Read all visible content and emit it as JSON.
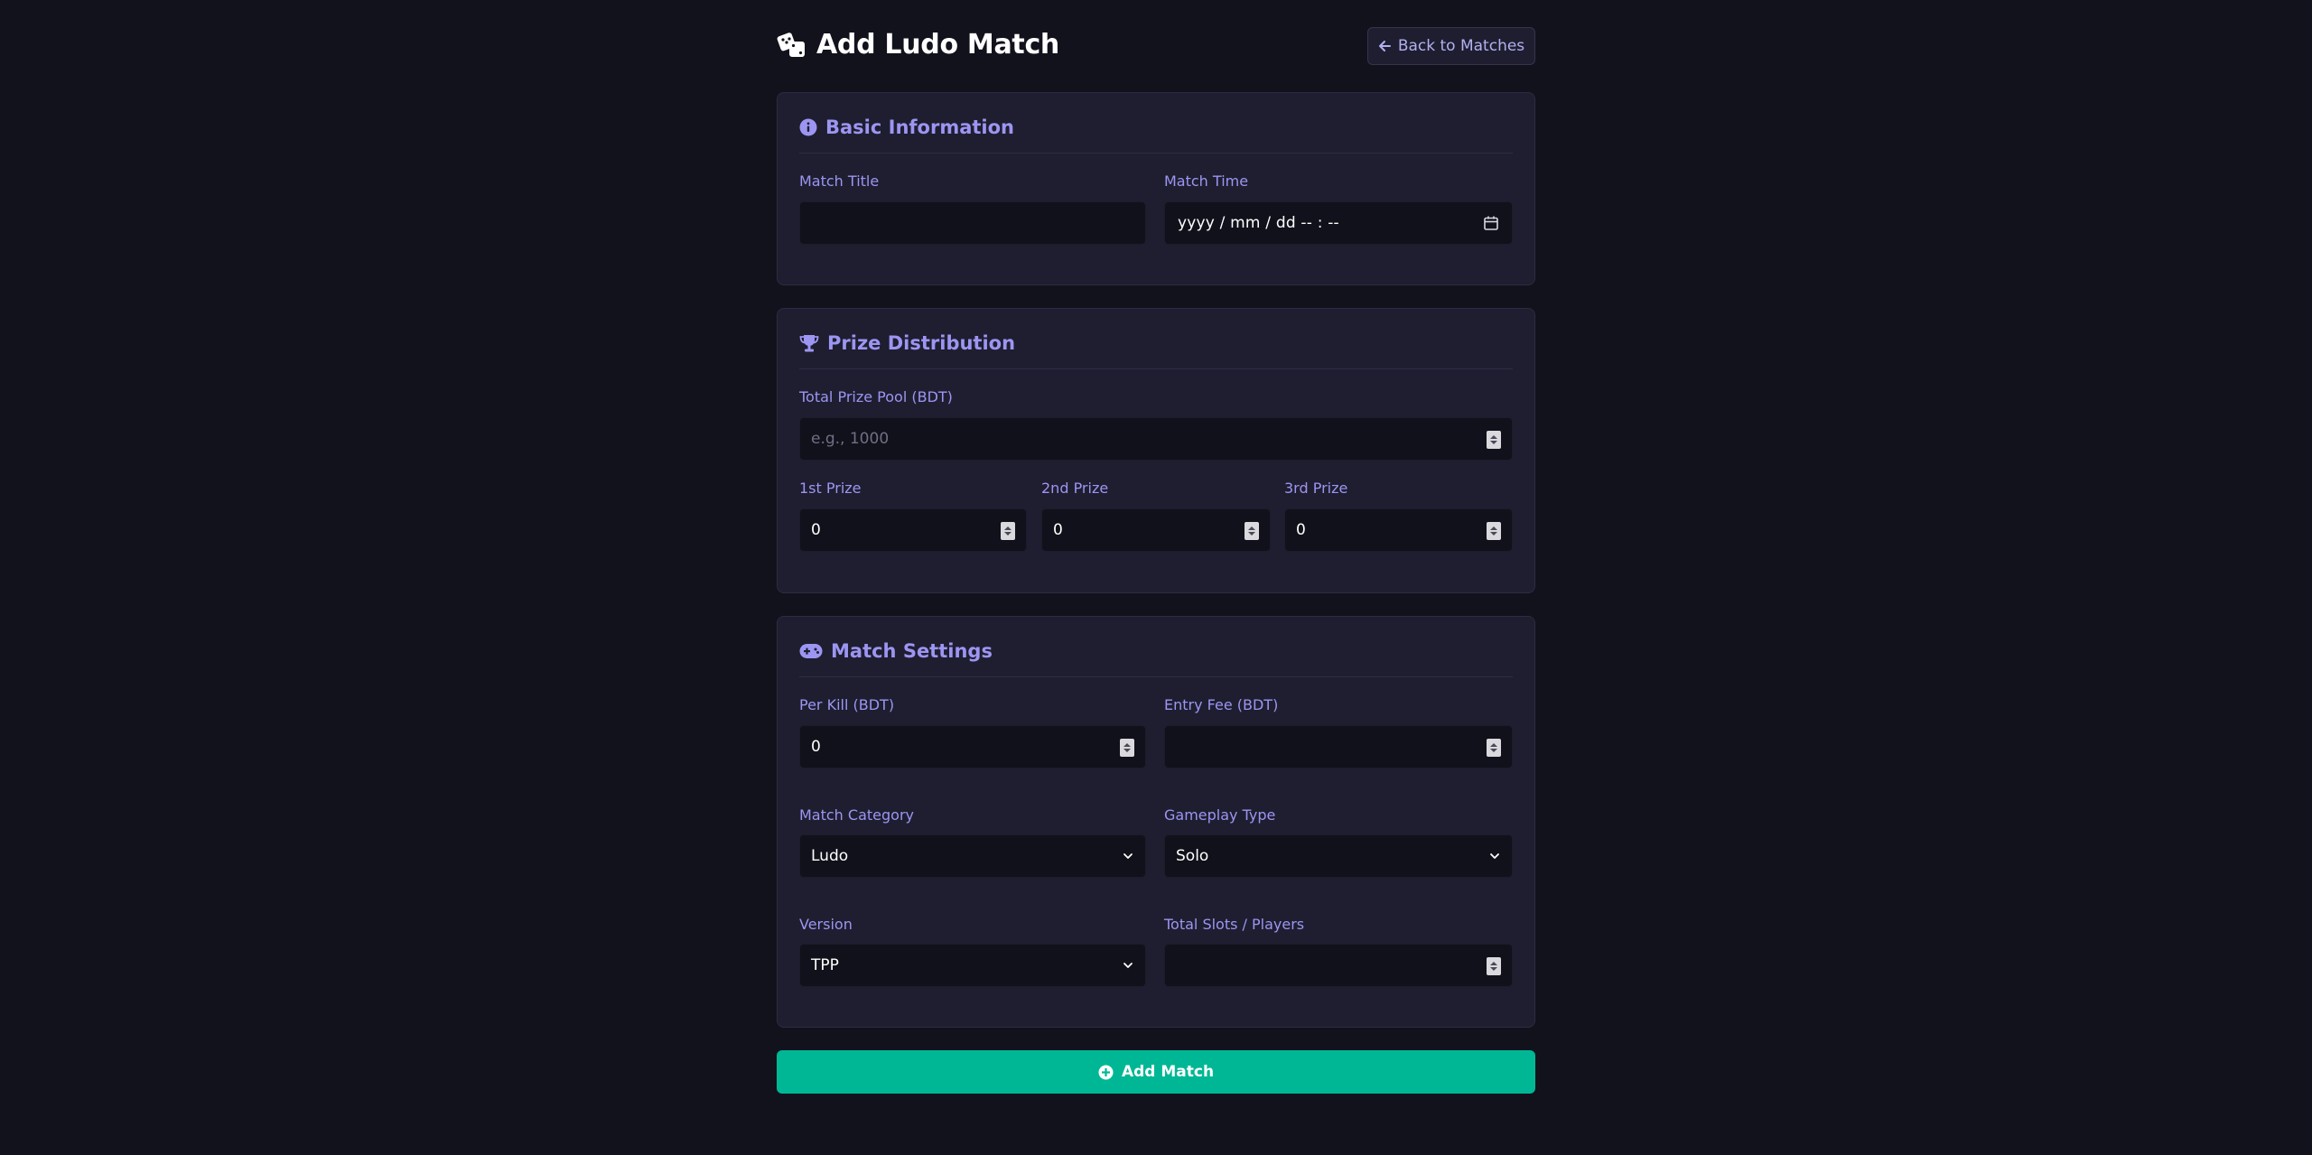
{
  "header": {
    "title": "Add Ludo Match",
    "back_label": "Back to Matches"
  },
  "basic": {
    "title": "Basic Information",
    "match_title_label": "Match Title",
    "match_title_value": "",
    "match_time_label": "Match Time",
    "match_time_placeholder": "yyyy / mm / dd  -- : --"
  },
  "prize": {
    "title": "Prize Distribution",
    "pool_label": "Total Prize Pool (BDT)",
    "pool_placeholder": "e.g., 1000",
    "first_label": "1st Prize",
    "first_value": "0",
    "second_label": "2nd Prize",
    "second_value": "0",
    "third_label": "3rd Prize",
    "third_value": "0"
  },
  "settings": {
    "title": "Match Settings",
    "per_kill_label": "Per Kill (BDT)",
    "per_kill_value": "0",
    "entry_fee_label": "Entry Fee (BDT)",
    "entry_fee_value": "",
    "category_label": "Match Category",
    "category_value": "Ludo",
    "gameplay_label": "Gameplay Type",
    "gameplay_value": "Solo",
    "version_label": "Version",
    "version_value": "TPP",
    "slots_label": "Total Slots / Players",
    "slots_value": ""
  },
  "submit_label": "Add Match",
  "colors": {
    "background": "#12121d",
    "card": "#1e1e30",
    "accent": "#9d95f2",
    "submit": "#00b795"
  }
}
